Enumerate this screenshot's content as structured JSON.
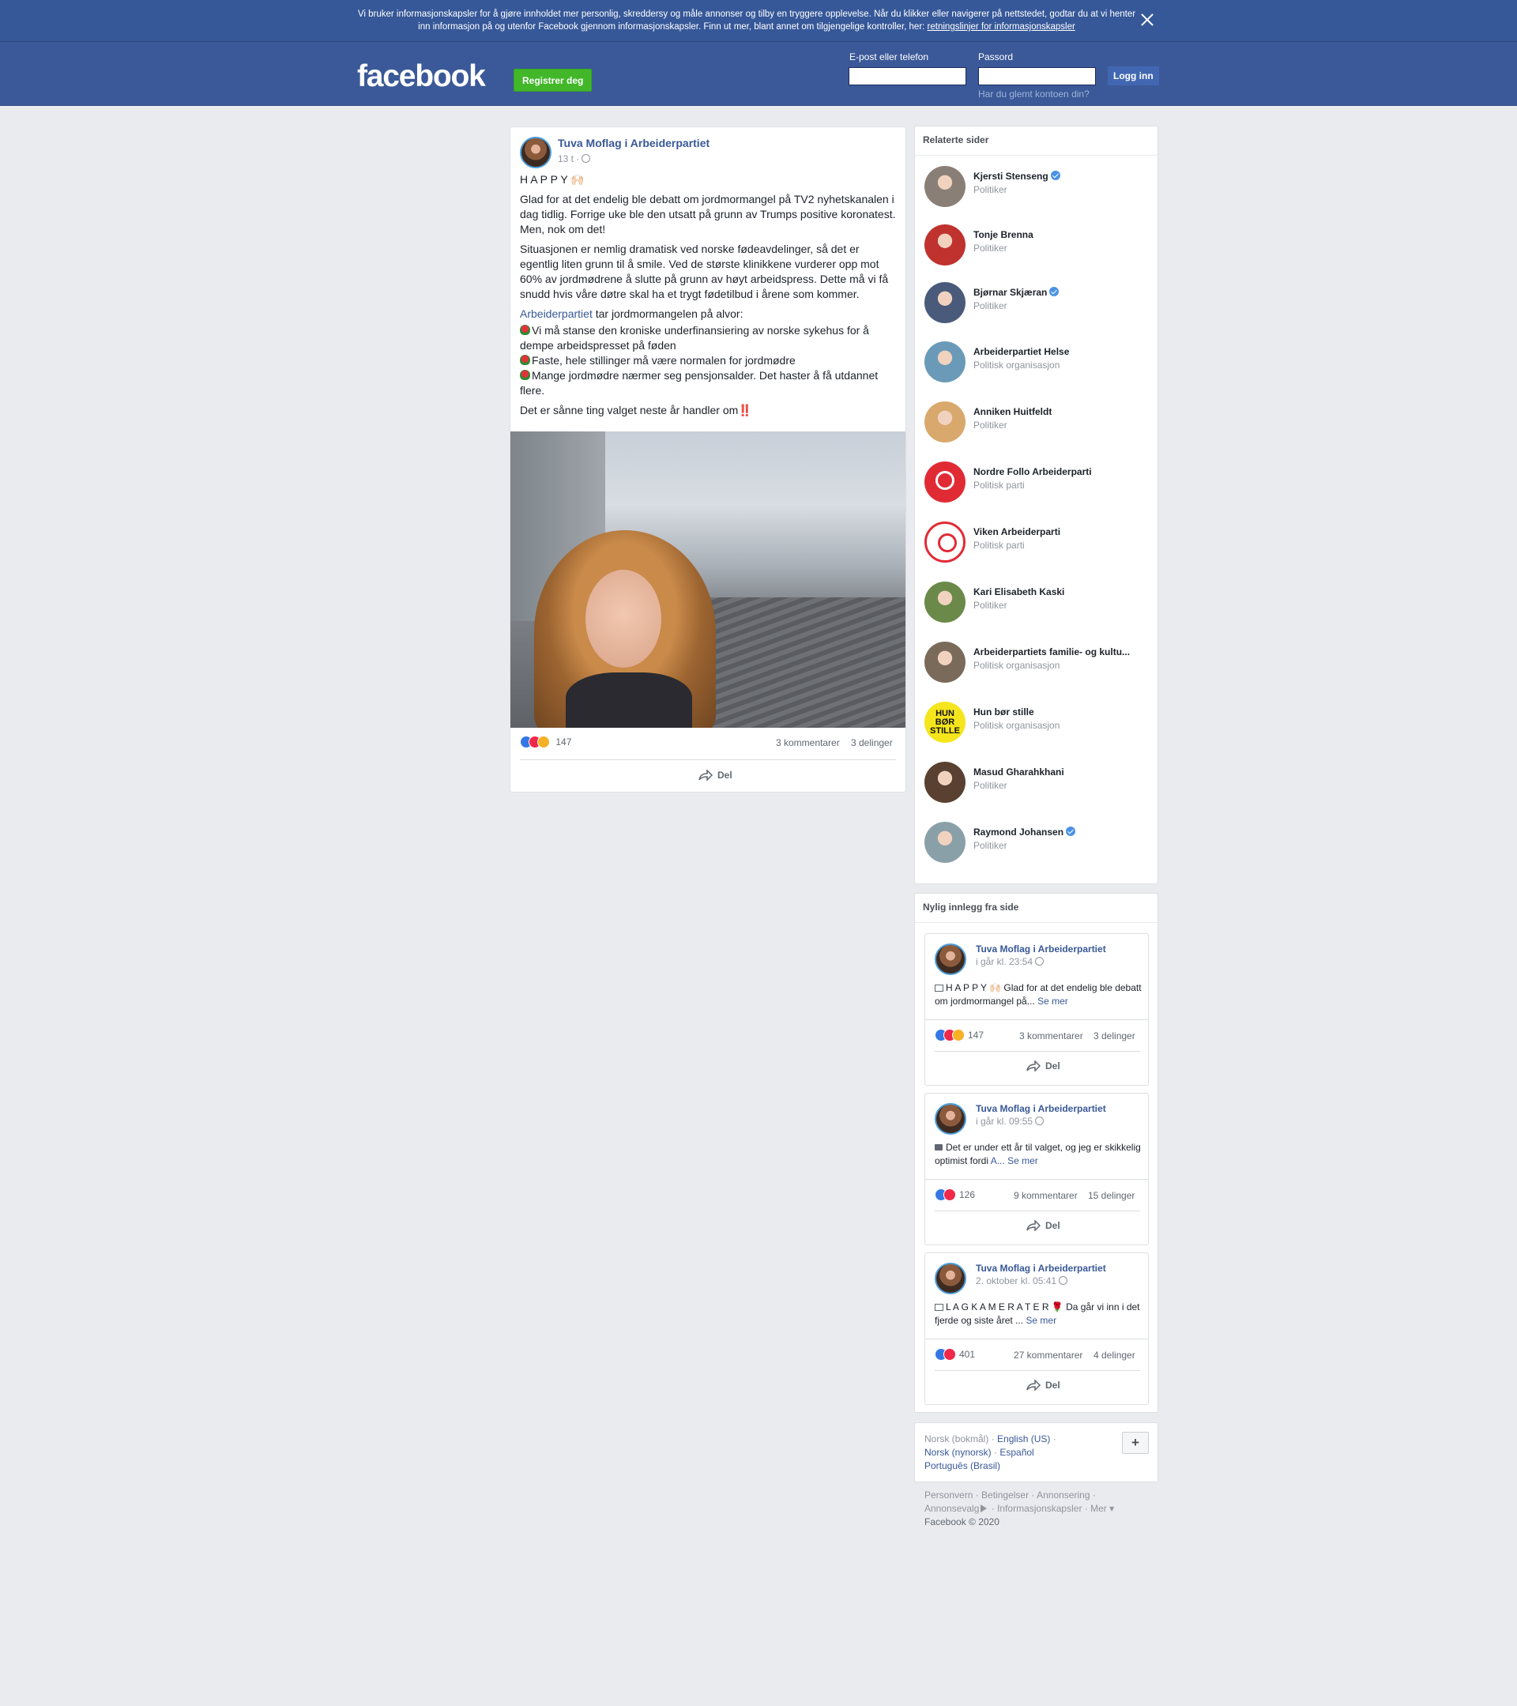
{
  "cookie_banner": {
    "text": "Vi bruker informasjonskapsler for å gjøre innholdet mer personlig, skreddersy og måle annonser og tilby en tryggere opplevelse. Når du klikker eller navigerer på nettstedet, godtar du at vi henter inn informasjon på og utenfor Facebook gjennom informasjonskapsler. Finn ut mer, blant annet om tilgjengelige kontroller, her: ",
    "link": "retningslinjer for informasjonskapsler"
  },
  "header": {
    "logo": "facebook",
    "register_label": "Registrer deg",
    "email_label": "E-post eller telefon",
    "password_label": "Passord",
    "login_label": "Logg inn",
    "forgot_label": "Har du glemt kontoen din?"
  },
  "post": {
    "author": "Tuva Moflag i Arbeiderpartiet",
    "time": "13 t ·",
    "title_line": "H A P P Y 🙌🏻",
    "para1": "Glad for at det endelig ble debatt om jordmormangel på TV2 nyhetskanalen i dag tidlig. Forrige uke ble den utsatt på grunn av Trumps positive koronatest. Men, nok om det!",
    "para2": "Situasjonen er nemlig dramatisk ved norske fødeavdelinger, så det er egentlig liten grunn til å smile. Ved de største klinikkene vurderer opp mot 60% av jordmødrene å slutte på grunn av høyt arbeidspress. Dette må vi få snudd hvis våre døtre skal ha et trygt fødetilbud i årene som kommer.",
    "mention": "Arbeiderpartiet",
    "mention_rest": " tar jordmormangelen på alvor:",
    "bullet1": "Vi må stanse den kroniske underfinansiering av norske sykehus for å dempe arbeidspresset på føden",
    "bullet2": "Faste, hele stillinger må være normalen for jordmødre",
    "bullet3": "Mange jordmødre nærmer seg pensjonsalder. Det haster å få utdannet flere.",
    "closing": "Det er sånne ting valget neste år handler om",
    "closing_mark": "‼️",
    "reactions": "147",
    "comments": "3 kommentarer",
    "shares": "3 delinger",
    "share_label": "Del"
  },
  "related": {
    "title": "Relaterte sider",
    "items": [
      {
        "name": "Kjersti Stenseng",
        "category": "Politiker",
        "verified": true,
        "color": "#8a7f76"
      },
      {
        "name": "Tonje Brenna",
        "category": "Politiker",
        "verified": false,
        "color": "#c0322e"
      },
      {
        "name": "Bjørnar Skjæran",
        "category": "Politiker",
        "verified": true,
        "color": "#4a5a7a"
      },
      {
        "name": "Arbeiderpartiet Helse",
        "category": "Politisk organisasjon",
        "verified": false,
        "color": "#6a9ab8"
      },
      {
        "name": "Anniken Huitfeldt",
        "category": "Politiker",
        "verified": false,
        "color": "#d9a86c"
      },
      {
        "name": "Nordre Follo Arbeiderparti",
        "category": "Politisk parti",
        "verified": false,
        "color": "#e02b35"
      },
      {
        "name": "Viken Arbeiderparti",
        "category": "Politisk parti",
        "verified": false,
        "color": "#e02b35"
      },
      {
        "name": "Kari Elisabeth Kaski",
        "category": "Politiker",
        "verified": false,
        "color": "#6b8a4a"
      },
      {
        "name": "Arbeiderpartiets familie- og kultu...",
        "category": "Politisk organisasjon",
        "verified": false,
        "color": "#7a6a5a"
      },
      {
        "name": "Hun bør stille",
        "category": "Politisk organisasjon",
        "verified": false,
        "color": "#f5e51c"
      },
      {
        "name": "Masud Gharahkhani",
        "category": "Politiker",
        "verified": false,
        "color": "#5a4030"
      },
      {
        "name": "Raymond Johansen",
        "category": "Politiker",
        "verified": true,
        "color": "#8aa0a8"
      }
    ],
    "hun_logo": "HUN BØR STILLE"
  },
  "recent": {
    "title": "Nylig innlegg fra side",
    "posts": [
      {
        "author": "Tuva Moflag i Arbeiderpartiet",
        "time": "i går kl. 23:54",
        "text": "H A P P Y 🙌🏻 Glad for at det endelig ble debatt om jordmormangel på...",
        "more": "Se mer",
        "reactions": "147",
        "comments": "3 kommentarer",
        "shares": "3 delinger",
        "share_label": "Del"
      },
      {
        "author": "Tuva Moflag i Arbeiderpartiet",
        "time": "i går kl. 09:55",
        "text": "Det er under ett år til valget, og jeg er skikkelig optimist fordi ",
        "link": "A...",
        "more": "Se mer",
        "reactions": "126",
        "comments": "9 kommentarer",
        "shares": "15 delinger",
        "share_label": "Del"
      },
      {
        "author": "Tuva Moflag i Arbeiderpartiet",
        "time": "2. oktober kl. 05:41",
        "text": "L A G K A M E R A T E R 🌹 Da går vi inn i det fjerde og siste året ...",
        "more": "Se mer",
        "reactions": "401",
        "comments": "27 kommentarer",
        "shares": "4 delinger",
        "share_label": "Del"
      }
    ]
  },
  "languages": {
    "current": "Norsk (bokmål)",
    "options": [
      "English (US)",
      "Norsk (nynorsk)",
      "Español",
      "Português (Brasil)"
    ],
    "plus_label": "+"
  },
  "footer": {
    "links": [
      "Personvern",
      "Betingelser",
      "Annonsering",
      "Annonsevalg",
      "Informasjonskapsler",
      "Mer"
    ],
    "copyright": "Facebook © 2020"
  },
  "colors": {
    "brand": "#3b5998",
    "banner": "#365899",
    "register": "#42b72a",
    "link": "#385898"
  }
}
